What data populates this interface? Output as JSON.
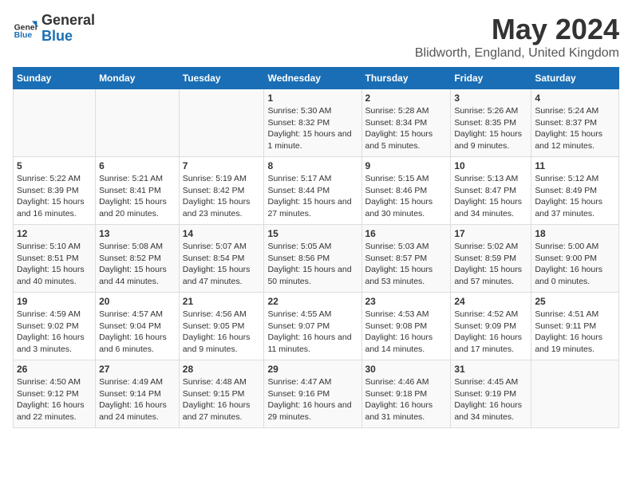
{
  "logo": {
    "general": "General",
    "blue": "Blue"
  },
  "title": "May 2024",
  "subtitle": "Blidworth, England, United Kingdom",
  "days_of_week": [
    "Sunday",
    "Monday",
    "Tuesday",
    "Wednesday",
    "Thursday",
    "Friday",
    "Saturday"
  ],
  "weeks": [
    [
      {
        "num": "",
        "info": ""
      },
      {
        "num": "",
        "info": ""
      },
      {
        "num": "",
        "info": ""
      },
      {
        "num": "1",
        "info": "Sunrise: 5:30 AM\nSunset: 8:32 PM\nDaylight: 15 hours\nand 1 minute."
      },
      {
        "num": "2",
        "info": "Sunrise: 5:28 AM\nSunset: 8:34 PM\nDaylight: 15 hours\nand 5 minutes."
      },
      {
        "num": "3",
        "info": "Sunrise: 5:26 AM\nSunset: 8:35 PM\nDaylight: 15 hours\nand 9 minutes."
      },
      {
        "num": "4",
        "info": "Sunrise: 5:24 AM\nSunset: 8:37 PM\nDaylight: 15 hours\nand 12 minutes."
      }
    ],
    [
      {
        "num": "5",
        "info": "Sunrise: 5:22 AM\nSunset: 8:39 PM\nDaylight: 15 hours\nand 16 minutes."
      },
      {
        "num": "6",
        "info": "Sunrise: 5:21 AM\nSunset: 8:41 PM\nDaylight: 15 hours\nand 20 minutes."
      },
      {
        "num": "7",
        "info": "Sunrise: 5:19 AM\nSunset: 8:42 PM\nDaylight: 15 hours\nand 23 minutes."
      },
      {
        "num": "8",
        "info": "Sunrise: 5:17 AM\nSunset: 8:44 PM\nDaylight: 15 hours\nand 27 minutes."
      },
      {
        "num": "9",
        "info": "Sunrise: 5:15 AM\nSunset: 8:46 PM\nDaylight: 15 hours\nand 30 minutes."
      },
      {
        "num": "10",
        "info": "Sunrise: 5:13 AM\nSunset: 8:47 PM\nDaylight: 15 hours\nand 34 minutes."
      },
      {
        "num": "11",
        "info": "Sunrise: 5:12 AM\nSunset: 8:49 PM\nDaylight: 15 hours\nand 37 minutes."
      }
    ],
    [
      {
        "num": "12",
        "info": "Sunrise: 5:10 AM\nSunset: 8:51 PM\nDaylight: 15 hours\nand 40 minutes."
      },
      {
        "num": "13",
        "info": "Sunrise: 5:08 AM\nSunset: 8:52 PM\nDaylight: 15 hours\nand 44 minutes."
      },
      {
        "num": "14",
        "info": "Sunrise: 5:07 AM\nSunset: 8:54 PM\nDaylight: 15 hours\nand 47 minutes."
      },
      {
        "num": "15",
        "info": "Sunrise: 5:05 AM\nSunset: 8:56 PM\nDaylight: 15 hours\nand 50 minutes."
      },
      {
        "num": "16",
        "info": "Sunrise: 5:03 AM\nSunset: 8:57 PM\nDaylight: 15 hours\nand 53 minutes."
      },
      {
        "num": "17",
        "info": "Sunrise: 5:02 AM\nSunset: 8:59 PM\nDaylight: 15 hours\nand 57 minutes."
      },
      {
        "num": "18",
        "info": "Sunrise: 5:00 AM\nSunset: 9:00 PM\nDaylight: 16 hours\nand 0 minutes."
      }
    ],
    [
      {
        "num": "19",
        "info": "Sunrise: 4:59 AM\nSunset: 9:02 PM\nDaylight: 16 hours\nand 3 minutes."
      },
      {
        "num": "20",
        "info": "Sunrise: 4:57 AM\nSunset: 9:04 PM\nDaylight: 16 hours\nand 6 minutes."
      },
      {
        "num": "21",
        "info": "Sunrise: 4:56 AM\nSunset: 9:05 PM\nDaylight: 16 hours\nand 9 minutes."
      },
      {
        "num": "22",
        "info": "Sunrise: 4:55 AM\nSunset: 9:07 PM\nDaylight: 16 hours\nand 11 minutes."
      },
      {
        "num": "23",
        "info": "Sunrise: 4:53 AM\nSunset: 9:08 PM\nDaylight: 16 hours\nand 14 minutes."
      },
      {
        "num": "24",
        "info": "Sunrise: 4:52 AM\nSunset: 9:09 PM\nDaylight: 16 hours\nand 17 minutes."
      },
      {
        "num": "25",
        "info": "Sunrise: 4:51 AM\nSunset: 9:11 PM\nDaylight: 16 hours\nand 19 minutes."
      }
    ],
    [
      {
        "num": "26",
        "info": "Sunrise: 4:50 AM\nSunset: 9:12 PM\nDaylight: 16 hours\nand 22 minutes."
      },
      {
        "num": "27",
        "info": "Sunrise: 4:49 AM\nSunset: 9:14 PM\nDaylight: 16 hours\nand 24 minutes."
      },
      {
        "num": "28",
        "info": "Sunrise: 4:48 AM\nSunset: 9:15 PM\nDaylight: 16 hours\nand 27 minutes."
      },
      {
        "num": "29",
        "info": "Sunrise: 4:47 AM\nSunset: 9:16 PM\nDaylight: 16 hours\nand 29 minutes."
      },
      {
        "num": "30",
        "info": "Sunrise: 4:46 AM\nSunset: 9:18 PM\nDaylight: 16 hours\nand 31 minutes."
      },
      {
        "num": "31",
        "info": "Sunrise: 4:45 AM\nSunset: 9:19 PM\nDaylight: 16 hours\nand 34 minutes."
      },
      {
        "num": "",
        "info": ""
      }
    ]
  ]
}
